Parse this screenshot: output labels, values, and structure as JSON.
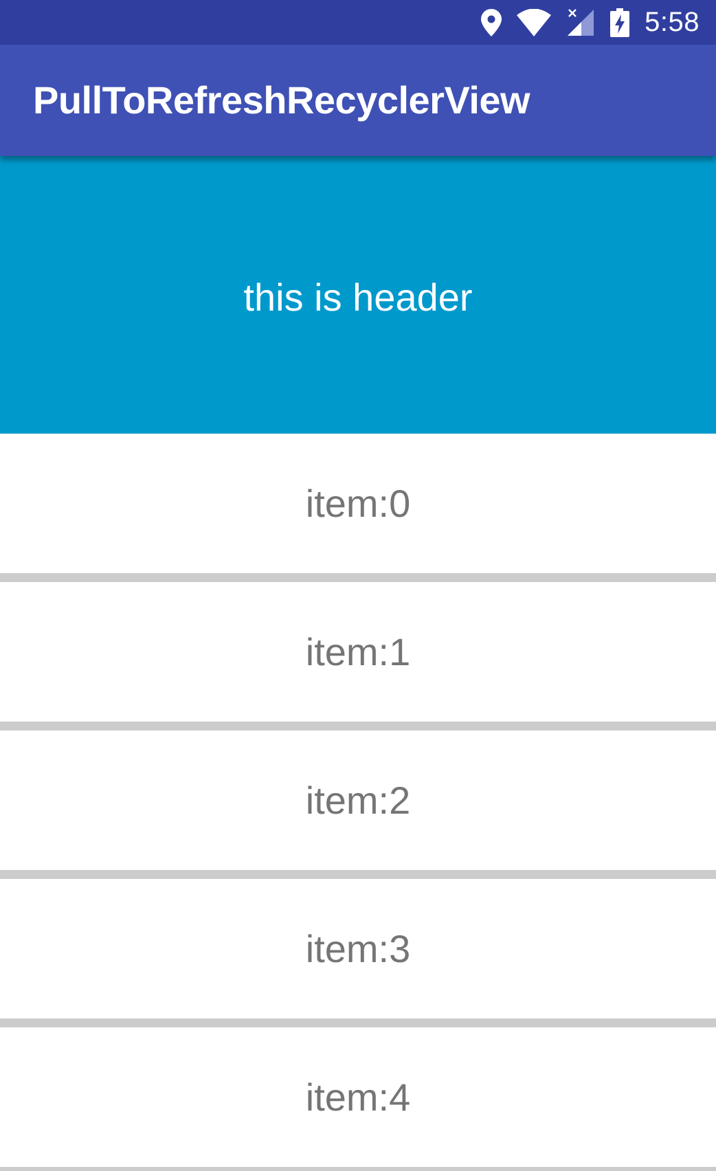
{
  "status_bar": {
    "time": "5:58",
    "icons": [
      "location-icon",
      "wifi-icon",
      "cell-signal-no-data-icon",
      "battery-charging-icon"
    ],
    "background": "#303F9F"
  },
  "app_bar": {
    "title": "PullToRefreshRecyclerView",
    "background": "#3F51B5"
  },
  "header": {
    "text": "this is header",
    "background": "#0099CC"
  },
  "list": {
    "items": [
      {
        "label": "item:0"
      },
      {
        "label": "item:1"
      },
      {
        "label": "item:2"
      },
      {
        "label": "item:3"
      },
      {
        "label": "item:4"
      }
    ],
    "divider_color": "#CCCCCC",
    "text_color": "#757575"
  }
}
